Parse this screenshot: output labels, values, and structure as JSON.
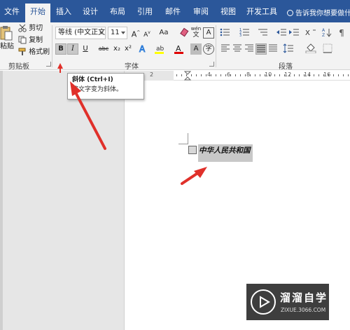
{
  "tabs": [
    {
      "label": "文件",
      "active": false
    },
    {
      "label": "开始",
      "active": true
    },
    {
      "label": "插入",
      "active": false
    },
    {
      "label": "设计",
      "active": false
    },
    {
      "label": "布局",
      "active": false
    },
    {
      "label": "引用",
      "active": false
    },
    {
      "label": "邮件",
      "active": false
    },
    {
      "label": "审阅",
      "active": false
    },
    {
      "label": "视图",
      "active": false
    },
    {
      "label": "开发工具",
      "active": false
    }
  ],
  "tell_me": "告诉我你想要做什么",
  "clipboard": {
    "paste_label": "粘贴",
    "cut_label": "剪切",
    "copy_label": "复制",
    "format_painter_label": "格式刷",
    "group_label": "剪贴板"
  },
  "font": {
    "name": "等线 (中文正文",
    "size": "11",
    "group_label": "字体",
    "bold": "B",
    "italic": "I",
    "underline": "U",
    "strike": "abc",
    "subscript": "x₂",
    "superscript": "x²",
    "grow": "A",
    "shrink": "A",
    "case": "Aa",
    "phonetic": "wén",
    "border_char": "A",
    "char_shade": "A"
  },
  "paragraph": {
    "group_label": "段落"
  },
  "tooltip": {
    "title": "斜体 (Ctrl+I)",
    "description": "将文字变为斜体。"
  },
  "document": {
    "text": "中华人民共和国"
  },
  "watermark": {
    "brand": "溜溜自学",
    "url": "ZIXUE.3066.COM"
  },
  "ruler_numbers": [
    "2",
    "4",
    "6",
    "8",
    "10",
    "12",
    "14",
    "16"
  ],
  "colors": {
    "tab_bar": "#2b579a",
    "ribbon": "#f3f3f3",
    "arrow": "#e0302a",
    "highlight_yellow": "#ffff00",
    "font_red": "#e00000"
  }
}
